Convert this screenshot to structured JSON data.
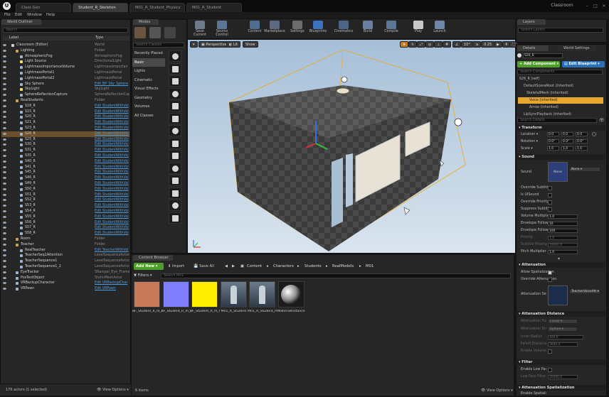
{
  "window": {
    "tabs": [
      "Class Gen",
      "Student_R_Skeleton",
      "M01_R_Student_Physics",
      "M01_R_Student"
    ],
    "project_name": "Classroom"
  },
  "menu": [
    "File",
    "Edit",
    "Window",
    "Help"
  ],
  "world_outliner": {
    "tab": "World Outliner",
    "search_placeholder": "Search",
    "col_label": "Label",
    "col_type": "Type",
    "rows": [
      {
        "label": "Classroom (Editor)",
        "type": "World",
        "indent": 0,
        "icon": "world",
        "link": false
      },
      {
        "label": "Lighting",
        "type": "Folder",
        "indent": 1,
        "icon": "folder",
        "link": false
      },
      {
        "label": "AtmosphericFog",
        "type": "AtmosphericFog",
        "indent": 2,
        "icon": "actor",
        "link": false
      },
      {
        "label": "Light Source",
        "type": "DirectionalLight",
        "indent": 2,
        "icon": "light",
        "link": false
      },
      {
        "label": "LightmassImportanceVolume",
        "type": "LightmassImportan",
        "indent": 2,
        "icon": "actor",
        "link": false
      },
      {
        "label": "LightmassPortal1",
        "type": "LightmassPortal",
        "indent": 2,
        "icon": "actor",
        "link": false
      },
      {
        "label": "LightmassPortal2",
        "type": "LightmassPortal",
        "indent": 2,
        "icon": "actor",
        "link": false
      },
      {
        "label": "Sky Sphere",
        "type": "Edit BP_Sky_Sphere",
        "indent": 2,
        "icon": "actor",
        "link": true
      },
      {
        "label": "SkyLight",
        "type": "SkyLight",
        "indent": 2,
        "icon": "light",
        "link": false
      },
      {
        "label": "SphereReflectionCapture",
        "type": "SphereReflectionCap",
        "indent": 2,
        "icon": "actor",
        "link": false
      },
      {
        "label": "RealStudents",
        "type": "Folder",
        "indent": 1,
        "icon": "folder",
        "link": false
      },
      {
        "label": "S18_R",
        "type": "Edit StudentWithVoi",
        "indent": 2,
        "icon": "actor",
        "link": true
      },
      {
        "label": "S15_R",
        "type": "Edit StudentWithVoi",
        "indent": 2,
        "icon": "actor",
        "link": true
      },
      {
        "label": "S20_R",
        "type": "Edit StudentWithVoi",
        "indent": 2,
        "icon": "actor",
        "link": true
      },
      {
        "label": "S21_R",
        "type": "Edit StudentWithVoi",
        "indent": 2,
        "icon": "actor",
        "link": true
      },
      {
        "label": "S23_R",
        "type": "Edit StudentWithVoi",
        "indent": 2,
        "icon": "actor",
        "link": true
      },
      {
        "label": "S26_R",
        "type": "Edit StudentWithVoi",
        "indent": 2,
        "icon": "actor",
        "link": true,
        "selected": true
      },
      {
        "label": "S25_R",
        "type": "Edit StudentWithVoi",
        "indent": 2,
        "icon": "actor",
        "link": true
      },
      {
        "label": "S30_R",
        "type": "Edit StudentWithVoi",
        "indent": 2,
        "icon": "actor",
        "link": true
      },
      {
        "label": "S31_R",
        "type": "Edit StudentWithVoi",
        "indent": 2,
        "icon": "actor",
        "link": true
      },
      {
        "label": "S35_R",
        "type": "Edit StudentWithVoi",
        "indent": 2,
        "icon": "actor",
        "link": true
      },
      {
        "label": "S40_R",
        "type": "Edit StudentWithVoi",
        "indent": 2,
        "icon": "actor",
        "link": true
      },
      {
        "label": "S41_R",
        "type": "Edit StudentWithVoi",
        "indent": 2,
        "icon": "actor",
        "link": true
      },
      {
        "label": "S45_R",
        "type": "Edit StudentWithVoi",
        "indent": 2,
        "icon": "actor",
        "link": true
      },
      {
        "label": "S46_R",
        "type": "Edit StudentWithVoi",
        "indent": 2,
        "icon": "actor",
        "link": true
      },
      {
        "label": "S49_R",
        "type": "Edit StudentWithVoi",
        "indent": 2,
        "icon": "actor",
        "link": true
      },
      {
        "label": "S50_R",
        "type": "Edit StudentWithVoi",
        "indent": 2,
        "icon": "actor",
        "link": true
      },
      {
        "label": "S51_R",
        "type": "Edit StudentWithVoi",
        "indent": 2,
        "icon": "actor",
        "link": true
      },
      {
        "label": "S52_R",
        "type": "Edit StudentWithVoi",
        "indent": 2,
        "icon": "actor",
        "link": true
      },
      {
        "label": "S53_R",
        "type": "Edit StudentWithVoi",
        "indent": 2,
        "icon": "actor",
        "link": true
      },
      {
        "label": "S54_R",
        "type": "Edit StudentWithVoi",
        "indent": 2,
        "icon": "actor",
        "link": true
      },
      {
        "label": "S55_R",
        "type": "Edit StudentWithVoi",
        "indent": 2,
        "icon": "actor",
        "link": true
      },
      {
        "label": "S56_R",
        "type": "Edit StudentWithVoi",
        "indent": 2,
        "icon": "actor",
        "link": true
      },
      {
        "label": "S57_R",
        "type": "Edit StudentWithVoi",
        "indent": 2,
        "icon": "actor",
        "link": true
      },
      {
        "label": "S58_R",
        "type": "Edit StudentWithVoi",
        "indent": 2,
        "icon": "actor",
        "link": true
      },
      {
        "label": "Room",
        "type": "Folder",
        "indent": 1,
        "icon": "folder",
        "link": false
      },
      {
        "label": "Teacher",
        "type": "Folder",
        "indent": 1,
        "icon": "folder",
        "link": false
      },
      {
        "label": "RealTeacher",
        "type": "Edit TeacherWithVoi",
        "indent": 2,
        "icon": "actor",
        "link": true
      },
      {
        "label": "TeacherSeq1Attention",
        "type": "LevelSequenceActor",
        "indent": 2,
        "icon": "actor",
        "link": false
      },
      {
        "label": "TeacherSequence1",
        "type": "LevelSequenceActor",
        "indent": 2,
        "icon": "actor",
        "link": false
      },
      {
        "label": "TeacherSequence1_2",
        "type": "LevelSequenceActor",
        "indent": 2,
        "icon": "actor",
        "link": false
      },
      {
        "label": "EyeTracker",
        "type": "SRanipal_Eye_Frame",
        "indent": 1,
        "icon": "actor",
        "link": false
      },
      {
        "label": "PosTestObject",
        "type": "StaticMeshActor",
        "indent": 1,
        "icon": "actor",
        "link": false
      },
      {
        "label": "VRBackupCharacter",
        "type": "Edit VRBackupChar",
        "indent": 1,
        "icon": "actor",
        "link": true
      },
      {
        "label": "VRPawn",
        "type": "Edit VRPawn",
        "indent": 1,
        "icon": "actor",
        "link": true
      }
    ],
    "footer_count": "176 actors (1 selected)",
    "view_options": "View Options"
  },
  "modes": {
    "tab": "Modes",
    "search_placeholder": "Search Classes",
    "categories": [
      "Recently Placed",
      "Basic",
      "Lights",
      "Cinematic",
      "Visual Effects",
      "Geometry",
      "Volumes",
      "All Classes"
    ],
    "active_category": "Basic"
  },
  "toolbar": {
    "buttons": [
      "Save Current",
      "Source Control",
      "Content",
      "Marketplace",
      "Settings",
      "Blueprints",
      "Cinematics",
      "Build",
      "Compile",
      "Play",
      "Launch"
    ]
  },
  "viewport": {
    "perspective": "Perspective",
    "lit": "Lit",
    "show": "Show",
    "snap_angle": "10°",
    "snap_scale": "0.25",
    "camera_speed": "4"
  },
  "content_browser": {
    "tab": "Content Browser",
    "add_new": "Add New",
    "import": "Import",
    "save_all": "Save All",
    "breadcrumb": [
      "Content",
      "Characters",
      "Students",
      "RealModels",
      "M01"
    ],
    "filters": "Filters",
    "search_placeholder": "Search M01",
    "assets": [
      {
        "name": "BF_Student_R_m_001_lambert1_BaseColor",
        "color": "#c87a5a"
      },
      {
        "name": "BF_Student_R_m_001_lambert1_Normal",
        "color": "#8080ff"
      },
      {
        "name": "BF_Student_R_m_001_lambert1_Occlusion",
        "color": "#ffee00"
      },
      {
        "name": "M01_R_Student",
        "color": "#3a4a5c"
      },
      {
        "name": "M01_R_Student_Physics",
        "color": "#3a4a5c"
      },
      {
        "name": "MaterialInstance",
        "color": "#1b1b1b"
      }
    ],
    "item_count": "6 items",
    "view_options": "View Options"
  },
  "layers": {
    "tab": "Layers",
    "search_placeholder": "Search Layers"
  },
  "details": {
    "tab": "Details",
    "tab2": "World Settings",
    "actor_name": "S26_R",
    "add_component": "+ Add Component",
    "edit_blueprint": "Edit Blueprint",
    "search_components": "Search Components",
    "components": [
      "S26_R (self)",
      "DefaultSceneRoot (Inherited)",
      "SkeletalMesh (Inherited)",
      "Voice (Inherited)",
      "Arrow (Inherited)",
      "LipSyncPlayback (Inherited)"
    ],
    "search_details": "Search Details",
    "transform": {
      "title": "Transform",
      "location_label": "Location",
      "location": [
        "0.0",
        "0.0",
        "0.0"
      ],
      "rotation_label": "Rotation",
      "rotation": [
        "0.0°",
        "0.0°",
        "0.0°"
      ],
      "scale_label": "Scale",
      "scale": [
        "1.0",
        "1.0",
        "1.0"
      ]
    },
    "sound": {
      "title": "Sound",
      "sound_label": "Sound",
      "sound_value": "None",
      "thumb": "None",
      "rows": [
        "Override Subtitle",
        "Is UISound",
        "Override Priority",
        "Suppress Subtitle"
      ],
      "volume_multiplier_label": "Volume Multiplier",
      "volume_multiplier": "1.0",
      "envelope_follower_attack_label": "Envelope Follower",
      "envelope_follower_attack": "10",
      "envelope_follower_release_label": "Envelope Follower",
      "envelope_follower_release": "100",
      "priority_label": "Priority",
      "priority": "1.0",
      "subtitle_priority_label": "Subtitle Priority",
      "subtitle_priority": "10000.0",
      "pitch_multiplier_label": "Pitch Multiplier",
      "pitch_multiplier": "1.0"
    },
    "attenuation": {
      "title": "Attenuation",
      "allow_spatialization": "Allow Spatialization",
      "override_attenuation": "Override Attenuation",
      "settings_label": "Attenuation Settings",
      "settings_value": "TeacherVoiceAtt"
    },
    "attenuation_distance": {
      "title": "Attenuation Distance",
      "function_label": "Attenuation Function",
      "function_value": "Linear",
      "shape_label": "Attenuation Shape",
      "shape_value": "Sphere",
      "inner_label": "Inner Radius",
      "inner_value": "400.0",
      "falloff_label": "Falloff Distance",
      "falloff_value": "3600.0",
      "enable_volume_label": "Enable Volume A"
    },
    "filter": {
      "title": "Filter",
      "low_pass_label": "Enable Low Pass",
      "low_pass_freq_label": "Low Pass Filter",
      "low_pass_freq_value": "20000.0"
    },
    "spatialization": {
      "title": "Attenuation Spatialization",
      "enable_label": "Enable Spatialization"
    }
  }
}
